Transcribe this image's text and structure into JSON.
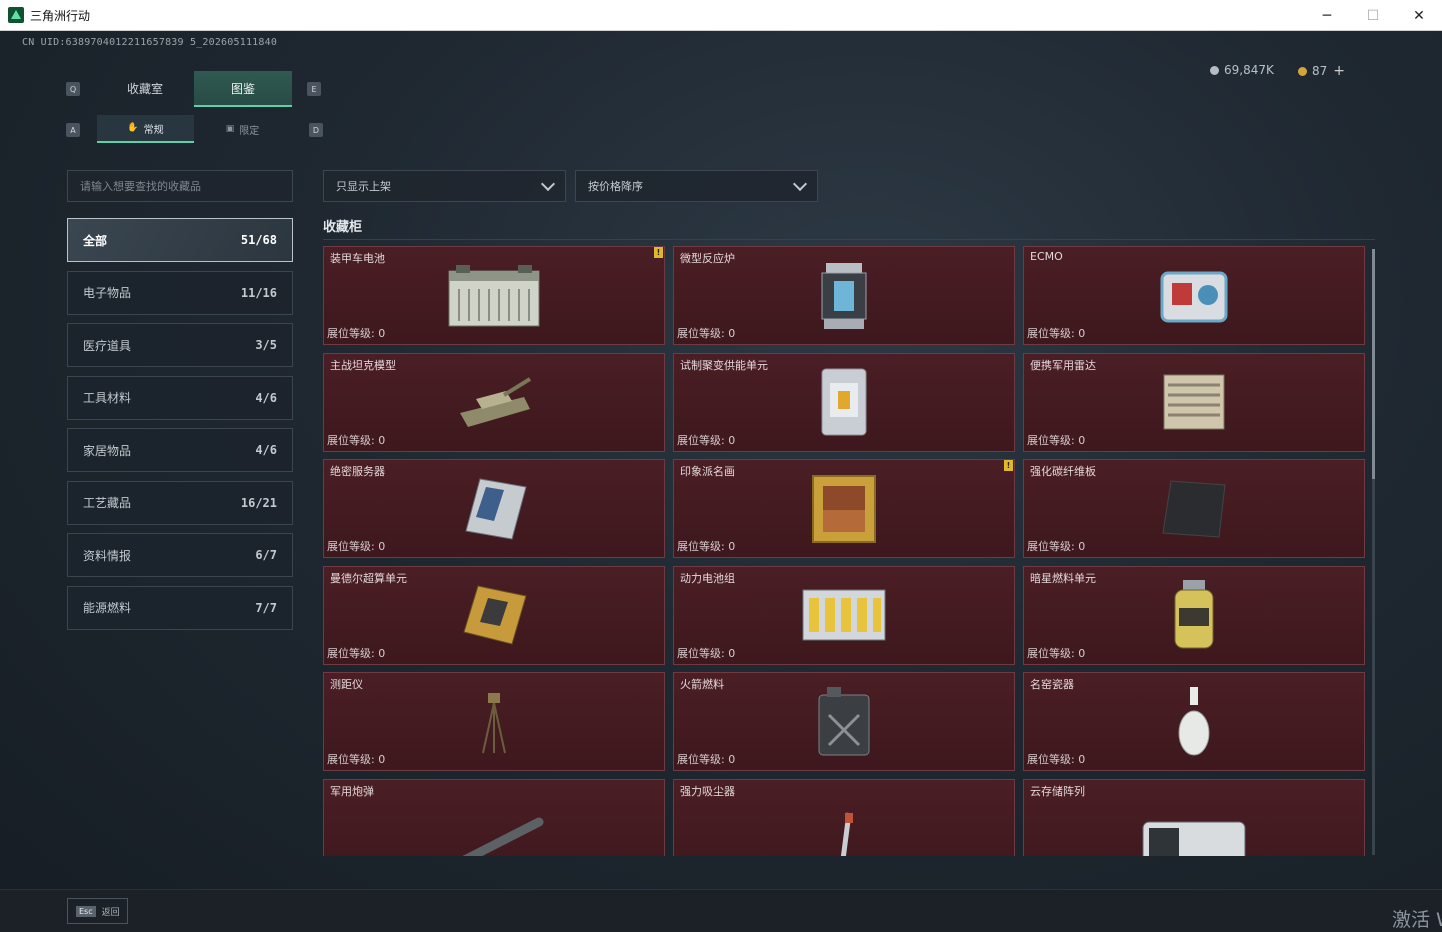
{
  "window": {
    "title": "三角洲行动"
  },
  "header": {
    "uid": "CN UID:6389704012211657839 5_202605111840"
  },
  "currency": [
    {
      "icon": "silver-coin-icon",
      "value": "69,847K"
    },
    {
      "icon": "gold-coin-icon",
      "value": "87"
    }
  ],
  "hints": {
    "q": "Q",
    "e": "E",
    "a": "A",
    "d": "D"
  },
  "tabs": [
    {
      "label": "收藏室",
      "active": false
    },
    {
      "label": "图鉴",
      "active": true
    }
  ],
  "subtabs": [
    {
      "label": "常规",
      "active": true
    },
    {
      "label": "限定",
      "active": false
    }
  ],
  "search": {
    "placeholder": "请输入想要查找的收藏品"
  },
  "filters": [
    {
      "label": "只显示上架"
    },
    {
      "label": "按价格降序"
    }
  ],
  "categories": [
    {
      "label": "全部",
      "count": "51/68",
      "active": true
    },
    {
      "label": "电子物品",
      "count": "11/16"
    },
    {
      "label": "医疗道具",
      "count": "3/5"
    },
    {
      "label": "工具材料",
      "count": "4/6"
    },
    {
      "label": "家居物品",
      "count": "4/6"
    },
    {
      "label": "工艺藏品",
      "count": "16/21"
    },
    {
      "label": "资料情报",
      "count": "6/7"
    },
    {
      "label": "能源燃料",
      "count": "7/7"
    }
  ],
  "section": {
    "title": "收藏柜"
  },
  "items": [
    {
      "name": "装甲车电池",
      "level": "展位等级: 0",
      "warn": true,
      "icon": "battery-icon"
    },
    {
      "name": "微型反应炉",
      "level": "展位等级: 0",
      "icon": "reactor-icon"
    },
    {
      "name": "ECMO",
      "level": "展位等级: 0",
      "icon": "ecmo-icon"
    },
    {
      "name": "主战坦克模型",
      "level": "展位等级: 0",
      "icon": "tank-icon"
    },
    {
      "name": "试制聚变供能单元",
      "level": "展位等级: 0",
      "icon": "fusion-unit-icon"
    },
    {
      "name": "便携军用雷达",
      "level": "展位等级: 0",
      "icon": "radar-icon"
    },
    {
      "name": "绝密服务器",
      "level": "展位等级: 0",
      "icon": "server-icon"
    },
    {
      "name": "印象派名画",
      "level": "展位等级: 0",
      "warn": true,
      "icon": "painting-icon"
    },
    {
      "name": "强化碳纤维板",
      "level": "展位等级: 0",
      "icon": "carbon-plate-icon"
    },
    {
      "name": "曼德尔超算单元",
      "level": "展位等级: 0",
      "icon": "cpu-icon"
    },
    {
      "name": "动力电池组",
      "level": "展位等级: 0",
      "icon": "battery-pack-icon"
    },
    {
      "name": "暗星燃料单元",
      "level": "展位等级: 0",
      "icon": "fuel-canister-icon"
    },
    {
      "name": "测距仪",
      "level": "展位等级: 0",
      "icon": "rangefinder-icon"
    },
    {
      "name": "火箭燃料",
      "level": "展位等级: 0",
      "icon": "jerrycan-icon"
    },
    {
      "name": "名窑瓷器",
      "level": "展位等级: 0",
      "icon": "vase-icon"
    },
    {
      "name": "军用炮弹",
      "level": "",
      "icon": "shell-icon"
    },
    {
      "name": "强力吸尘器",
      "level": "",
      "icon": "vacuum-icon"
    },
    {
      "name": "云存储阵列",
      "level": "",
      "icon": "storage-array-icon"
    }
  ],
  "footer": {
    "esc_key": "Esc",
    "back_label": "返回"
  },
  "watermark": "激活 W"
}
